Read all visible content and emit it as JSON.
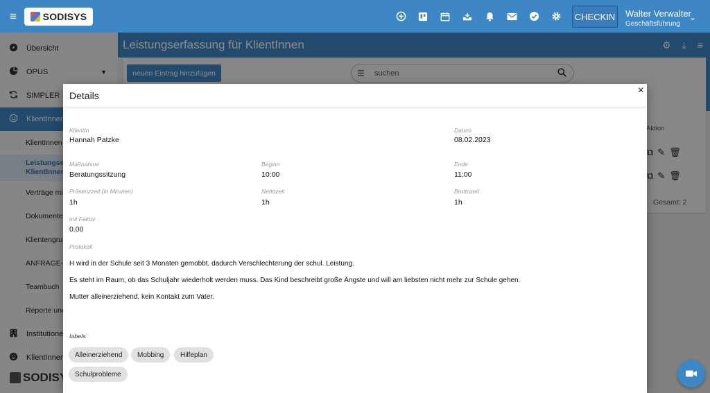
{
  "app": {
    "brand": "SODISYS"
  },
  "topbar": {
    "icons": [
      "plus-circle-icon",
      "trello-icon",
      "calendar-icon",
      "inbox-icon",
      "bell-icon",
      "mail-icon",
      "check-circle-icon",
      "gear-icon"
    ],
    "checkin_label": "CHECKIN",
    "user_name": "Walter Verwalter",
    "user_role": "Geschäftsführung"
  },
  "sidebar": {
    "items": [
      {
        "label": "Übersicht",
        "icon": "compass-icon"
      },
      {
        "label": "OPUS",
        "icon": "pie-icon"
      },
      {
        "label": "SIMPLER",
        "icon": "refresh-icon"
      },
      {
        "label": "KlientInnen",
        "icon": "smile-icon"
      }
    ],
    "subitems": [
      "KlientInnen",
      "Leistungserfassung für KlientInnen",
      "Verträge mit KlientInnen",
      "Dokumente",
      "Klientengruppen",
      "ANFRAGE-VERWALTUNG",
      "Teambuch",
      "Reporte und Statistiken"
    ],
    "subitems_short": [
      "KlientInnen",
      "Leistungser",
      "KlientInnen",
      "Verträge mit",
      "Dokumente",
      "Klientengrup",
      "ANFRAGE-V",
      "Teambuch",
      "Reporte und"
    ],
    "bottom_items": [
      {
        "label": "Institutione",
        "icon": "building-icon"
      },
      {
        "label": "KlientInnen",
        "icon": "smile-icon"
      }
    ],
    "footer_brand": "SODISYS"
  },
  "main": {
    "title": "Leistungserfassung für KlientInnen",
    "add_button": "neuen Eintrag hinzufügen",
    "search_placeholder": "suchen",
    "aktion_header": "Aktion",
    "gesamt": "Gesamt:  2"
  },
  "modal": {
    "title": "Details",
    "close": "×",
    "fields": {
      "klientin_label": "KlientIn",
      "klientin": "Hannah Patzke",
      "datum_label": "Datum",
      "datum": "08.02.2023",
      "massnahme_label": "Maßnahme",
      "massnahme": "Beratungssitzung",
      "beginn_label": "Beginn",
      "beginn": "10:00",
      "ende_label": "Ende",
      "ende": "11:00",
      "praesenz_label": "Präsenzzeit (in Minuten)",
      "praesenz": "1h",
      "netto_label": "Nettozeit",
      "netto": "1h",
      "brutto_label": "Bruttozeit",
      "brutto": "1h",
      "faktor_label": "mit Faktor",
      "faktor": "0.00",
      "protokoll_label": "Protokoll"
    },
    "protokoll": [
      "H wird in der Schule seit 3 Monaten gemobbt, dadurch Verschlechterung der schul. Leistung.",
      "Es steht im Raum, ob das Schuljahr wiederholt werden muss. Das Kind beschreibt große Ängste und will am liebsten nicht mehr zur Schule gehen.",
      "Mutter alleinerziehend, kein Kontakt zum Vater."
    ],
    "labels_title": "labels",
    "labels": [
      "Alleinerziehend",
      "Mobbing",
      "Hilfeplan",
      "Schulprobleme"
    ]
  }
}
